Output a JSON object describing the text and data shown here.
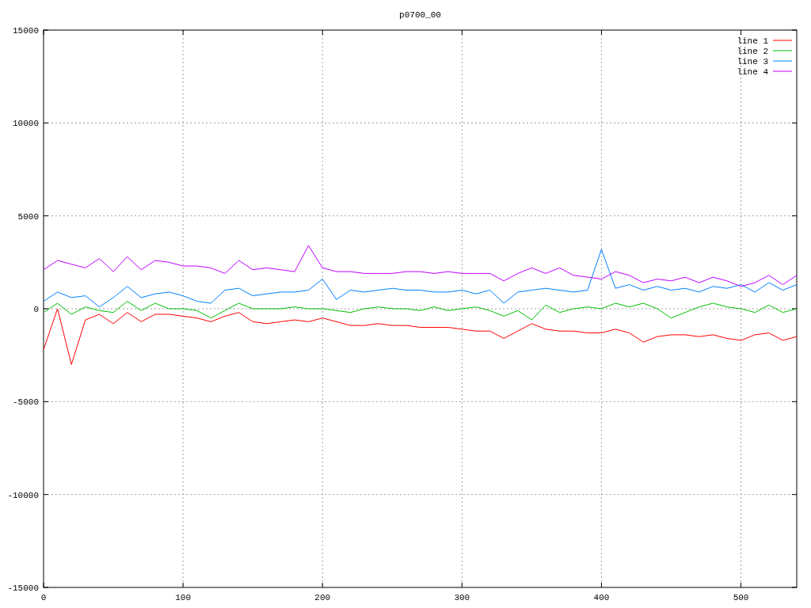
{
  "plot": {
    "chart_data": {
      "type": "line",
      "title": "p0700_00",
      "x": [
        0,
        10,
        20,
        30,
        40,
        50,
        60,
        70,
        80,
        90,
        100,
        110,
        120,
        130,
        140,
        150,
        160,
        170,
        180,
        190,
        200,
        210,
        220,
        230,
        240,
        250,
        260,
        270,
        280,
        290,
        300,
        310,
        320,
        330,
        340,
        350,
        360,
        370,
        380,
        390,
        400,
        410,
        420,
        430,
        440,
        450,
        460,
        470,
        480,
        490,
        500,
        510,
        520,
        530,
        540
      ],
      "series": [
        {
          "name": "line 1",
          "color": "#ff0000",
          "values": [
            -2200,
            0,
            -3000,
            -600,
            -300,
            -800,
            -200,
            -700,
            -300,
            -300,
            -400,
            -500,
            -700,
            -400,
            -200,
            -700,
            -800,
            -700,
            -600,
            -700,
            -500,
            -700,
            -900,
            -900,
            -800,
            -900,
            -900,
            -1000,
            -1000,
            -1000,
            -1100,
            -1200,
            -1200,
            -1600,
            -1200,
            -800,
            -1100,
            -1200,
            -1200,
            -1300,
            -1300,
            -1100,
            -1300,
            -1800,
            -1500,
            -1400,
            -1400,
            -1500,
            -1400,
            -1600,
            -1700,
            -1400,
            -1300,
            -1700,
            -1500
          ]
        },
        {
          "name": "line 2",
          "color": "#00c000",
          "values": [
            -200,
            300,
            -300,
            100,
            -100,
            -200,
            400,
            -100,
            300,
            0,
            0,
            -100,
            -500,
            -100,
            300,
            0,
            0,
            0,
            100,
            0,
            0,
            -100,
            -200,
            0,
            100,
            0,
            0,
            -100,
            100,
            -100,
            0,
            100,
            -100,
            -400,
            -100,
            -600,
            200,
            -200,
            0,
            100,
            0,
            300,
            100,
            300,
            0,
            -500,
            -200,
            100,
            300,
            100,
            0,
            -200,
            200,
            -200,
            0
          ]
        },
        {
          "name": "line 3",
          "color": "#0080ff",
          "values": [
            400,
            900,
            600,
            700,
            100,
            600,
            1200,
            600,
            800,
            900,
            700,
            400,
            300,
            1000,
            1100,
            700,
            800,
            900,
            900,
            1000,
            1600,
            500,
            1000,
            900,
            1000,
            1100,
            1000,
            1000,
            900,
            900,
            1000,
            800,
            1000,
            300,
            900,
            1000,
            1100,
            1000,
            900,
            1000,
            3200,
            1100,
            1300,
            1000,
            1200,
            1000,
            1100,
            900,
            1200,
            1100,
            1300,
            900,
            1400,
            1000,
            1300
          ]
        },
        {
          "name": "line 4",
          "color": "#c000ff",
          "values": [
            2100,
            2600,
            2400,
            2200,
            2700,
            2000,
            2800,
            2100,
            2600,
            2500,
            2300,
            2300,
            2200,
            1900,
            2600,
            2100,
            2200,
            2100,
            2000,
            3400,
            2200,
            2000,
            2000,
            1900,
            1900,
            1900,
            2000,
            2000,
            1900,
            2000,
            1900,
            1900,
            1900,
            1500,
            1900,
            2200,
            1900,
            2200,
            1800,
            1700,
            1600,
            2000,
            1800,
            1400,
            1600,
            1500,
            1700,
            1400,
            1700,
            1500,
            1200,
            1400,
            1800,
            1300,
            1800
          ]
        }
      ],
      "grid": true,
      "legend": true,
      "xlim": [
        0,
        540
      ],
      "ylim": [
        -15000,
        15000
      ],
      "xticks": [
        0,
        100,
        200,
        300,
        400,
        500
      ],
      "yticks": [
        -15000,
        -10000,
        -5000,
        0,
        5000,
        10000,
        15000
      ]
    }
  }
}
